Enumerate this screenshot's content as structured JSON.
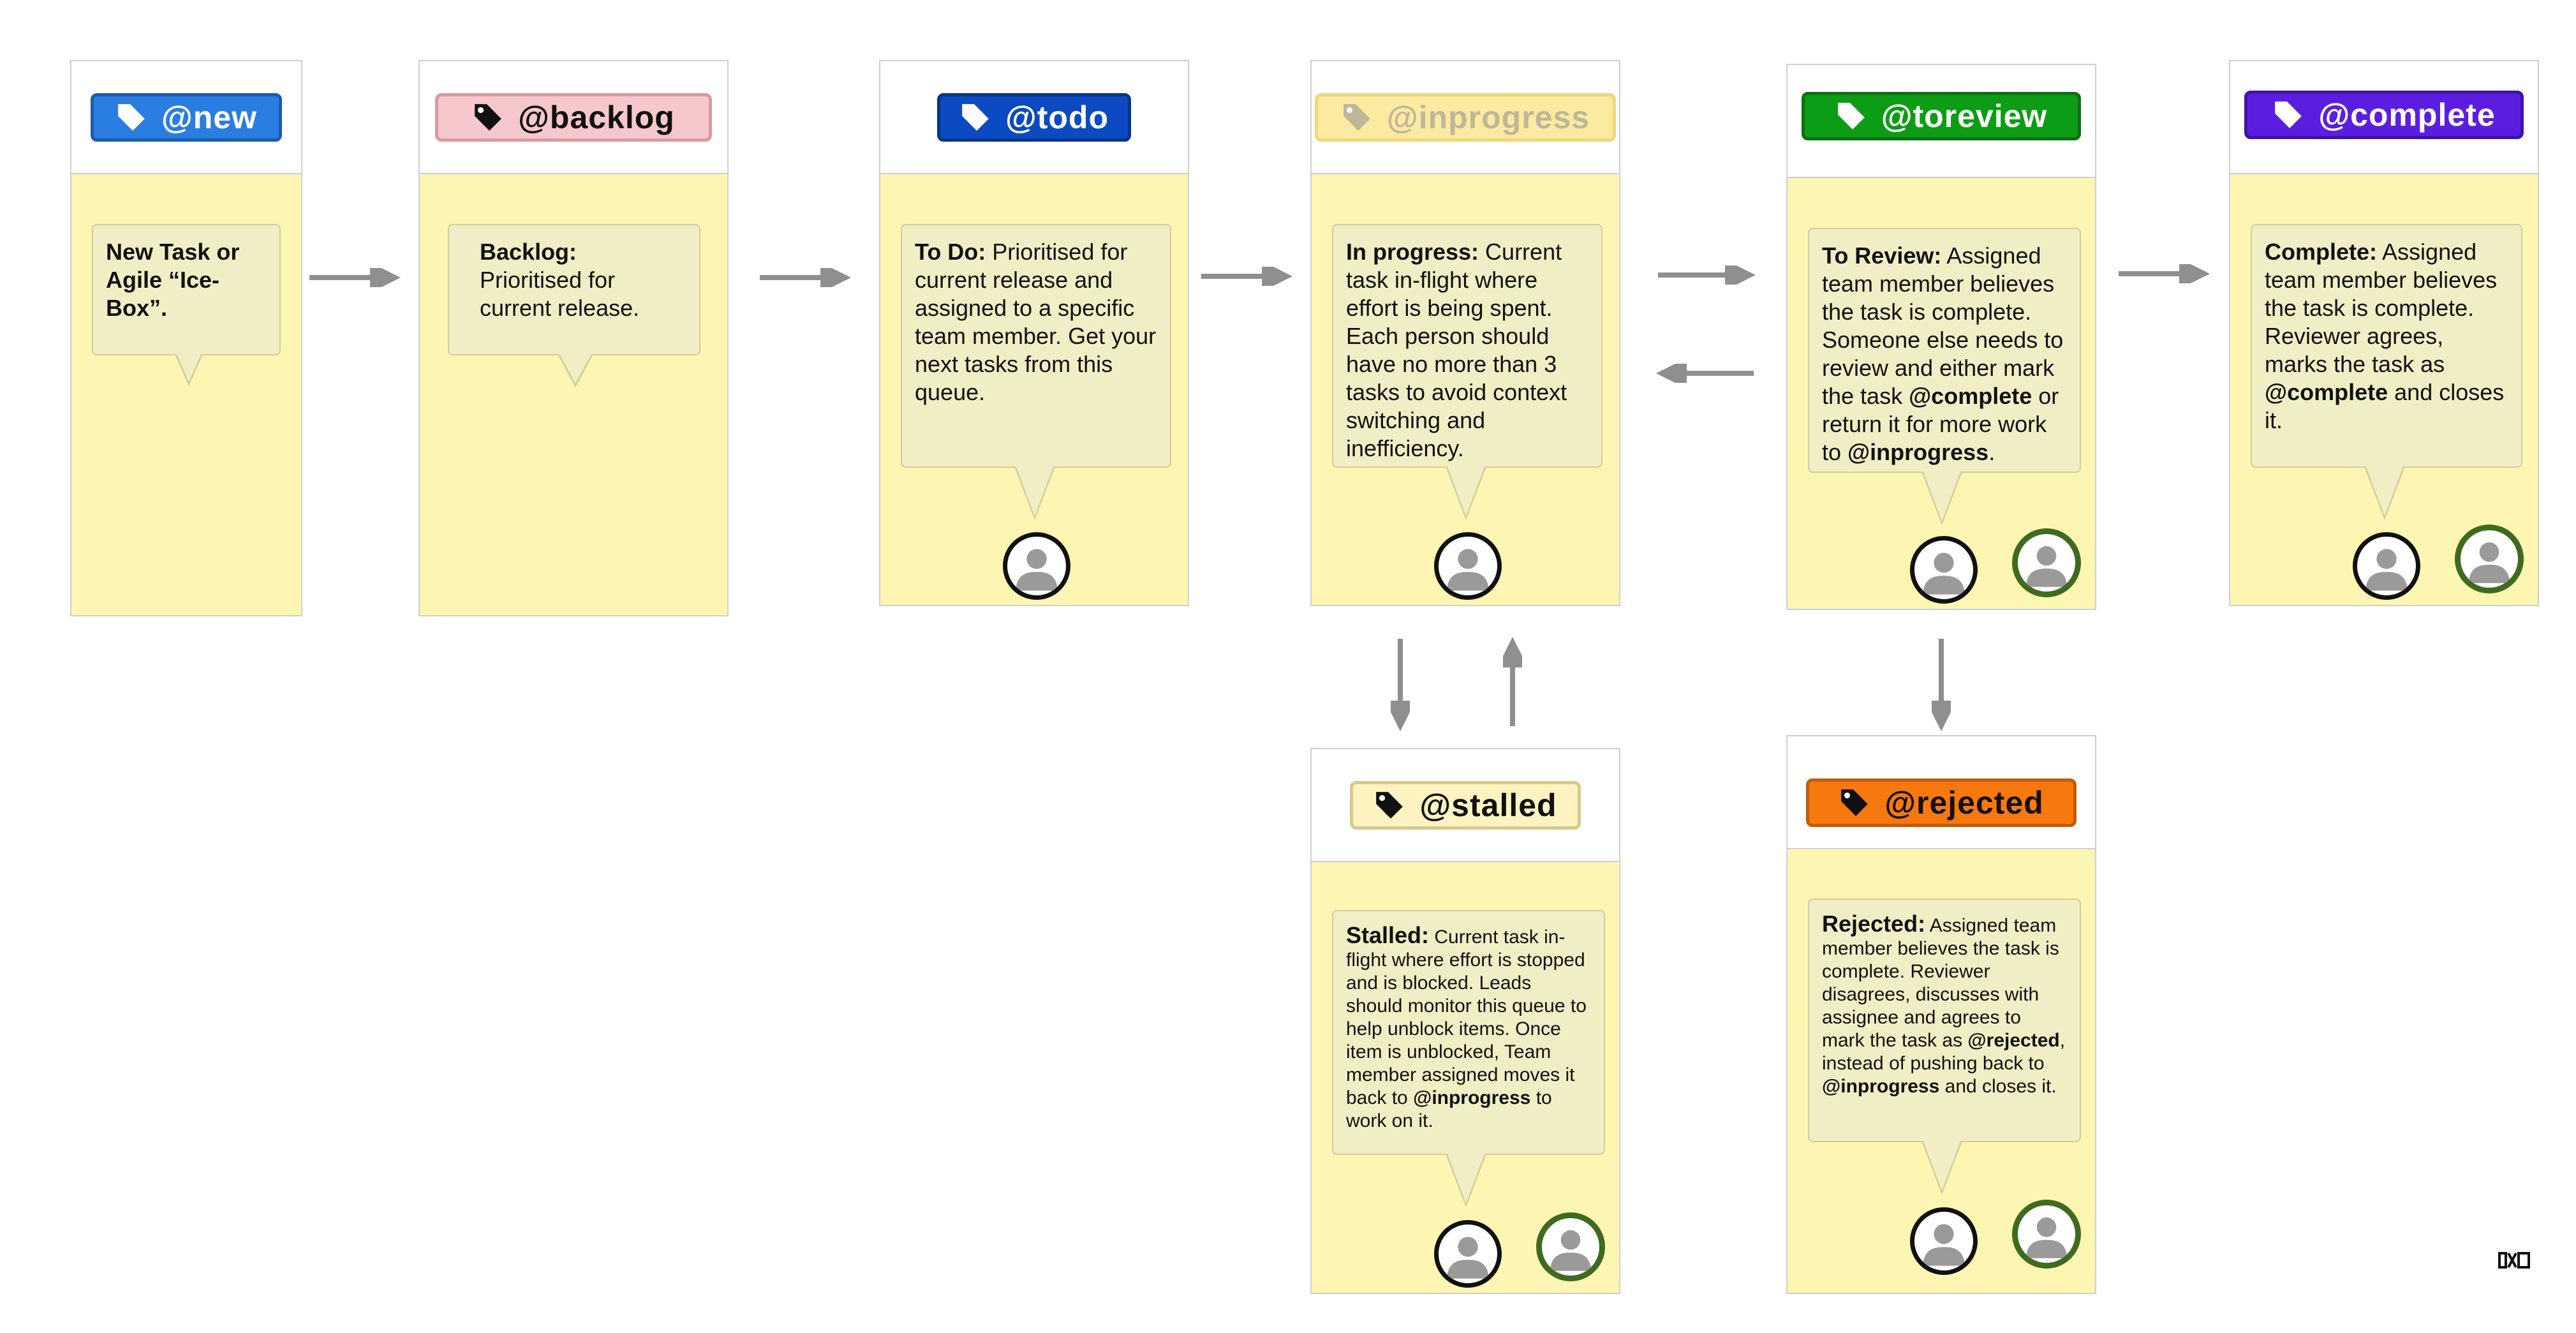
{
  "columns": {
    "new": {
      "tag": "@new",
      "tag_colors": {
        "bg": "#2a7de1",
        "border": "#1b5cad",
        "text": "#ffffff"
      },
      "bubble": {
        "bold": "New Task or Agile “Ice-Box”.",
        "text": ""
      }
    },
    "backlog": {
      "tag": "@backlog",
      "tag_colors": {
        "bg": "#f6c8cb",
        "border": "#d99aa0",
        "text": "#111111"
      },
      "bubble": {
        "bold": "Backlog:",
        "text": "Prioritised for current release."
      }
    },
    "todo": {
      "tag": "@todo",
      "tag_colors": {
        "bg": "#0b4ac1",
        "border": "#08348a",
        "text": "#ffffff"
      },
      "bubble": {
        "bold": "To Do:",
        "text": " Prioritised for current release and assigned to a specific team member. Get your next tasks from this queue."
      }
    },
    "inprogress": {
      "tag": "@inprogress",
      "tag_colors": {
        "bg": "#fbeaa0",
        "border": "#efd77a",
        "text": "#bfb79a"
      },
      "bubble": {
        "bold": "In progress:",
        "text": " Current task in-flight where effort is being spent. Each person should have no more than 3 tasks to avoid context switching and inefficiency."
      }
    },
    "toreview": {
      "tag": "@toreview",
      "tag_colors": {
        "bg": "#0d9c16",
        "border": "#0b7212",
        "text": "#ffffff"
      },
      "bubble": {
        "bold": "To Review:",
        "text1": " Assigned team member believes the task is complete. Someone else needs to review and either mark the task ",
        "kw1": "@complete",
        "text2": " or return it for more work to ",
        "kw2": "@inprogress",
        "text3": "."
      }
    },
    "complete": {
      "tag": "@complete",
      "tag_colors": {
        "bg": "#5b1ee0",
        "border": "#3f12a8",
        "text": "#ffffff"
      },
      "bubble": {
        "bold": "Complete:",
        "text1": " Assigned team member believes the task is complete. Reviewer agrees, marks the task as ",
        "kw1": "@complete",
        "text2": " and closes it."
      }
    },
    "stalled": {
      "tag": "@stalled",
      "tag_colors": {
        "bg": "#fdf3c0",
        "border": "#d8c88a",
        "text": "#111111"
      },
      "bubble": {
        "bold": "Stalled:",
        "text1": " Current task in-flight where effort is stopped and is blocked. Leads should monitor this queue to help unblock items. Once item is unblocked, Team member assigned moves it back to ",
        "kw1": "@inprogress",
        "text2": " to work on it."
      }
    },
    "rejected": {
      "tag": "@rejected",
      "tag_colors": {
        "bg": "#f7780e",
        "border": "#c45a04",
        "text": "#111111"
      },
      "bubble": {
        "bold": "Rejected:",
        "text1": " Assigned team member believes the task is complete. Reviewer disagrees, discusses with assignee and agrees to mark the task as ",
        "kw1": "@rejected",
        "text2": ", instead of pushing back to ",
        "kw3": "@inprogress",
        "text3": " and closes it."
      }
    }
  },
  "icons": {
    "tag": "tag-icon",
    "user": "user-avatar-icon",
    "reviewer": "reviewer-avatar-icon",
    "logo": "logo-icon"
  },
  "colors": {
    "column_fill": "#fdf5b2",
    "bubble_fill": "#f1eec5",
    "arrow": "#8f8f8f",
    "reviewer_ring": "#3f6b20"
  }
}
